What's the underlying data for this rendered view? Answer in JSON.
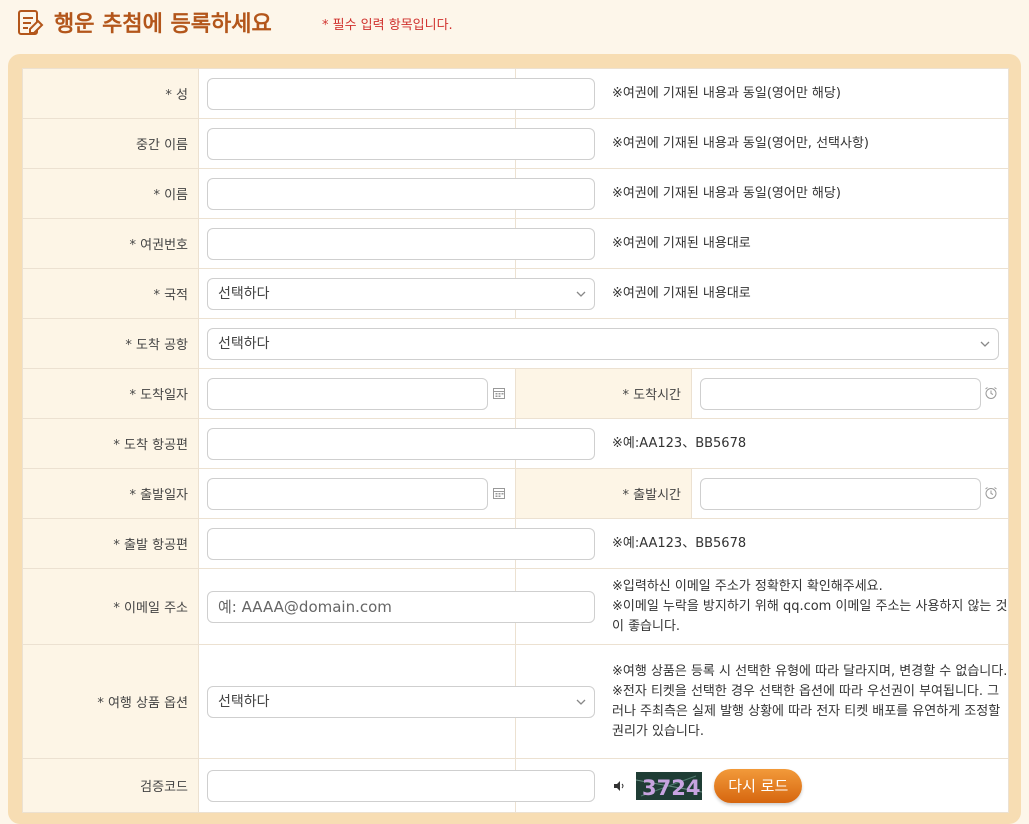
{
  "header": {
    "title": "행운 추첨에 등록하세요",
    "required_note": "* 필수 입력 항목입니다."
  },
  "form": {
    "last_name": {
      "label": "* 성",
      "note": "※여권에 기재된 내용과 동일(영어만 해당)"
    },
    "middle_name": {
      "label": "중간 이름",
      "note": "※여권에 기재된 내용과 동일(영어만, 선택사항)"
    },
    "first_name": {
      "label": "* 이름",
      "note": "※여권에 기재된 내용과 동일(영어만 해당)"
    },
    "passport": {
      "label": "* 여권번호",
      "note": "※여권에 기재된 내용대로"
    },
    "nationality": {
      "label": "* 국적",
      "value": "선택하다",
      "note": "※여권에 기재된 내용대로"
    },
    "arrival_airport": {
      "label": "* 도착 공항",
      "value": "선택하다"
    },
    "arrival_date": {
      "label": "* 도착일자"
    },
    "arrival_time": {
      "label": "* 도착시간"
    },
    "arrival_flight": {
      "label": "* 도착 항공편",
      "note": "※예:AA123、BB5678"
    },
    "departure_date": {
      "label": "* 출발일자"
    },
    "departure_time": {
      "label": "* 출발시간"
    },
    "departure_flight": {
      "label": "* 출발 항공편",
      "note": "※예:AA123、BB5678"
    },
    "email": {
      "label": "* 이메일 주소",
      "placeholder": "예: AAAA@domain.com",
      "note_line1": "※입력하신 이메일 주소가 정확한지 확인해주세요.",
      "note_line2": "※이메일 누락을 방지하기 위해 qq.com 이메일 주소는 사용하지 않는 것이 좋습니다."
    },
    "travel_product": {
      "label": "* 여행 상품 옵션",
      "value": "선택하다",
      "note_line1": "※여행 상품은 등록 시 선택한 유형에 따라 달라지며, 변경할 수 없습니다.",
      "note_line2": "※전자 티켓을 선택한 경우 선택한 옵션에 따라 우선권이 부여됩니다. 그러나 주최측은 실제 발행 상황에 따라 전자 티켓 배포를 유연하게 조정할 권리가 있습니다."
    },
    "verification": {
      "label": "검증코드",
      "captcha_text": "3724",
      "reload_label": "다시 로드"
    }
  },
  "colors": {
    "title": "#b3561b",
    "required": "#d0312d",
    "panel": "#f7ddb3",
    "label_bg": "#fdf5e6",
    "button": "#e0731a"
  },
  "icons": [
    "form-edit-icon",
    "chevron-down-icon",
    "calendar-icon",
    "clock-icon",
    "speaker-icon"
  ]
}
